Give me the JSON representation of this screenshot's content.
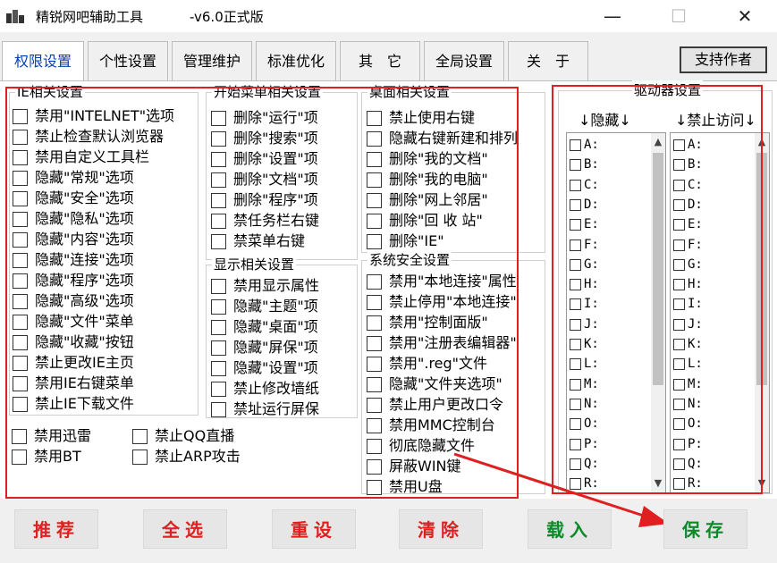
{
  "titlebar": {
    "title": "精锐网吧辅助工具",
    "version": "-v6.0正式版",
    "min": "—",
    "max": "☐",
    "close": "✕"
  },
  "tabs": [
    "权限设置",
    "个性设置",
    "管理维护",
    "标准优化",
    "其　它",
    "全局设置",
    "关　于"
  ],
  "support_label": "支持作者",
  "groups": {
    "ie": {
      "title": "IE相关设置",
      "items": [
        "禁用\"INTELNET\"选项",
        "禁止检查默认浏览器",
        "禁用自定义工具栏",
        "隐藏\"常规\"选项",
        "隐藏\"安全\"选项",
        "隐藏\"隐私\"选项",
        "隐藏\"内容\"选项",
        "隐藏\"连接\"选项",
        "隐藏\"程序\"选项",
        "隐藏\"高级\"选项",
        "隐藏\"文件\"菜单",
        "隐藏\"收藏\"按钮",
        "禁止更改IE主页",
        "禁用IE右键菜单",
        "禁止IE下载文件"
      ]
    },
    "extra": {
      "items": [
        "禁用迅雷",
        "禁止QQ直播",
        "禁用BT",
        "禁止ARP攻击"
      ]
    },
    "start": {
      "title": "开始菜单相关设置",
      "items": [
        "删除\"运行\"项",
        "删除\"搜索\"项",
        "删除\"设置\"项",
        "删除\"文档\"项",
        "删除\"程序\"项",
        "禁任务栏右键",
        "禁菜单右键"
      ]
    },
    "display": {
      "title": "显示相关设置",
      "items": [
        "禁用显示属性",
        "隐藏\"主题\"项",
        "隐藏\"桌面\"项",
        "隐藏\"屏保\"项",
        "隐藏\"设置\"项",
        "禁止修改墙纸",
        "禁址运行屏保"
      ]
    },
    "desktop": {
      "title": "桌面相关设置",
      "items": [
        "禁止使用右键",
        "隐藏右键新建和排列",
        "删除\"我的文档\"",
        "删除\"我的电脑\"",
        "删除\"网上邻居\"",
        "删除\"回 收 站\"",
        "删除\"IE\""
      ]
    },
    "security": {
      "title": "系统安全设置",
      "items": [
        "禁用\"本地连接\"属性",
        "禁止停用\"本地连接\"",
        "禁用\"控制面版\"",
        "禁用\"注册表编辑器\"",
        "禁用\".reg\"文件",
        "隐藏\"文件夹选项\"",
        "禁止用户更改口令",
        "禁用MMC控制台",
        "彻底隐藏文件",
        "屏蔽WIN键",
        "禁用U盘"
      ]
    }
  },
  "drives": {
    "title": "驱动器设置",
    "hide_label": "↓隐藏↓",
    "deny_label": "↓禁止访问↓",
    "letters": [
      "A:",
      "B:",
      "C:",
      "D:",
      "E:",
      "F:",
      "G:",
      "H:",
      "I:",
      "J:",
      "K:",
      "L:",
      "M:",
      "N:",
      "O:",
      "P:",
      "Q:",
      "R:"
    ]
  },
  "buttons": [
    {
      "label": "推荐",
      "color": "#e02020"
    },
    {
      "label": "全选",
      "color": "#e02020"
    },
    {
      "label": "重设",
      "color": "#e02020"
    },
    {
      "label": "清除",
      "color": "#e02020"
    },
    {
      "label": "载入",
      "color": "#0c8a2a"
    },
    {
      "label": "保存",
      "color": "#0c8a2a"
    }
  ],
  "colors": {
    "annotation": "#e02020",
    "active_tab": "#0a3fb3"
  }
}
